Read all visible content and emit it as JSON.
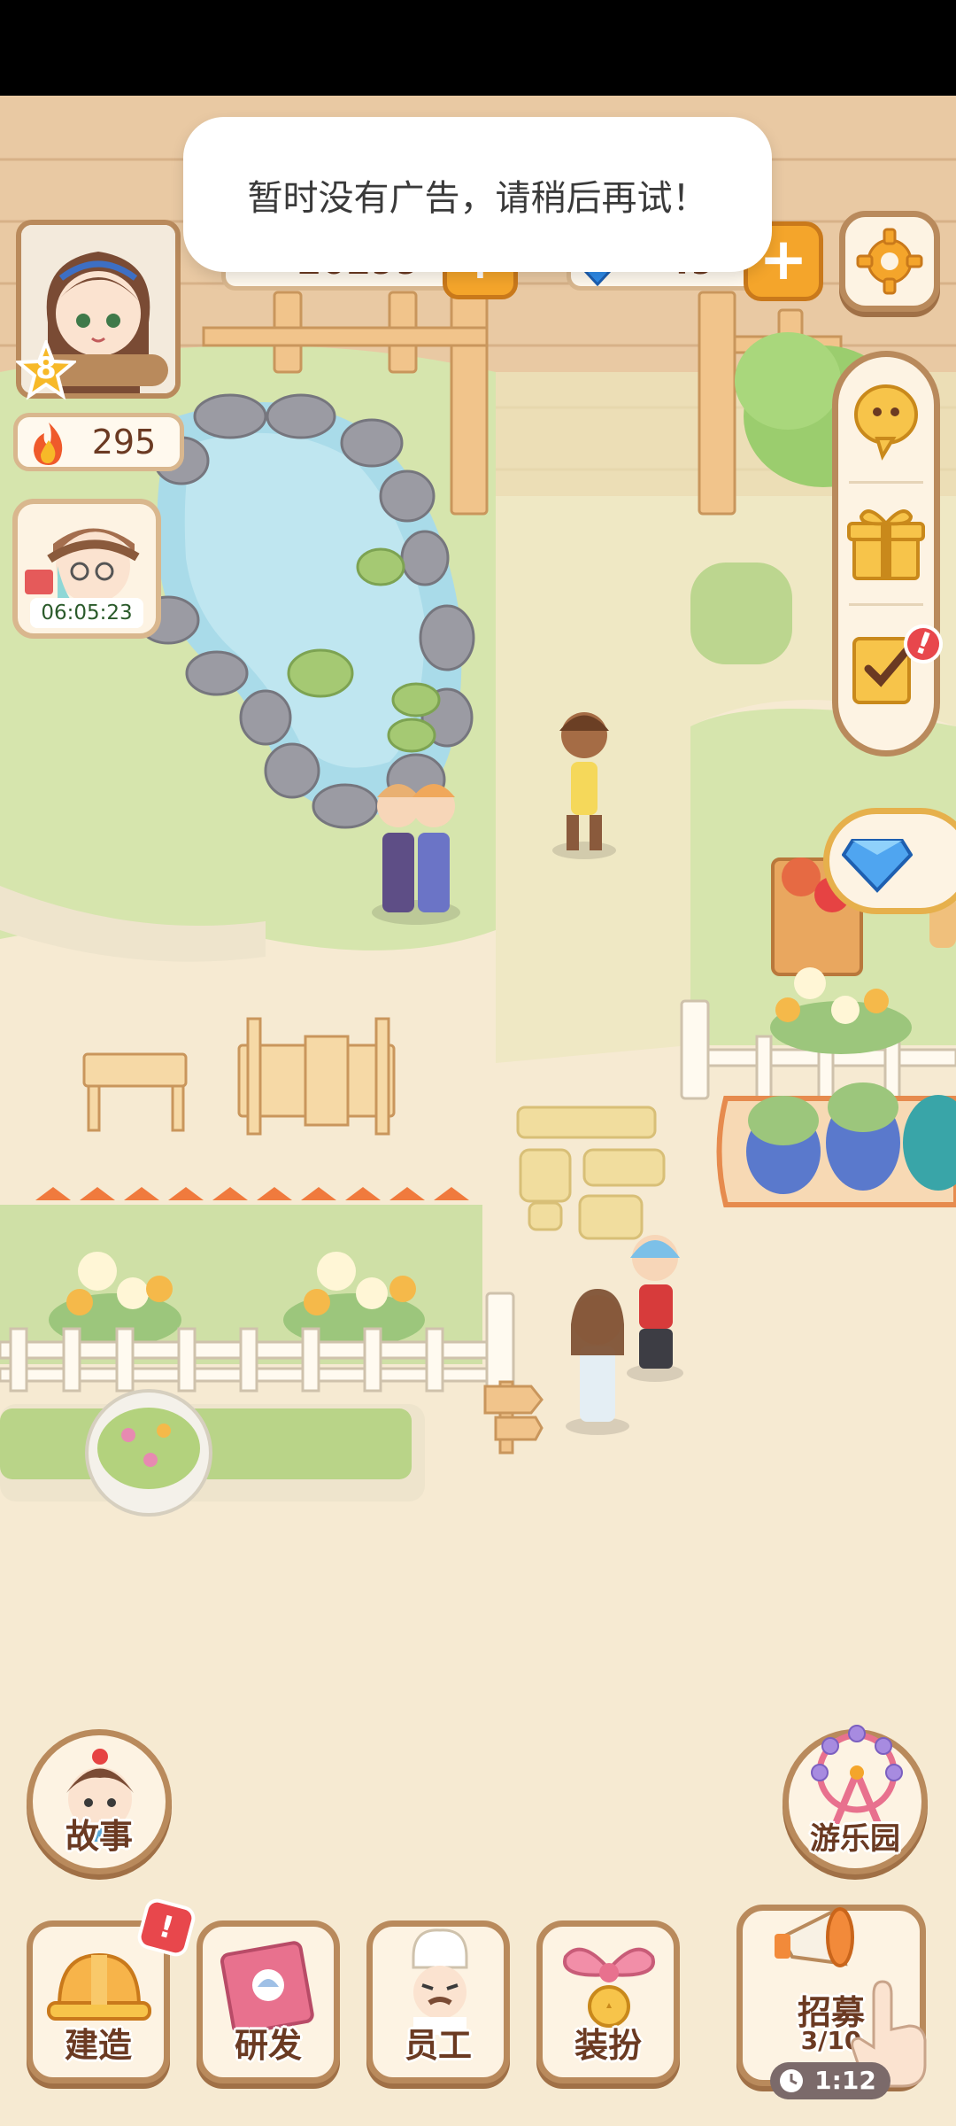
{
  "toast": {
    "message": "暂时没有广告，请稍后再试！"
  },
  "player": {
    "level": "8",
    "energy": "295"
  },
  "currency": {
    "coins": "20299",
    "gems": "49"
  },
  "event": {
    "timer": "06:05:23"
  },
  "side_menu": [
    {
      "icon": "chat-bubble-icon"
    },
    {
      "icon": "gift-box-icon"
    },
    {
      "icon": "checklist-icon",
      "has_alert": true
    }
  ],
  "bottom_nav": {
    "story": "故事",
    "amusement_park": "游乐园",
    "build": "建造",
    "research": "研发",
    "staff": "员工",
    "dress_up": "装扮",
    "recruit": "招募",
    "recruit_count": "3/10",
    "recruit_timer": "1:12"
  },
  "colors": {
    "accent_orange": "#f4a52b",
    "button_brown": "#b98a5c",
    "alert_red": "#e8474c",
    "grass": "#cfe0a6",
    "pond": "#9ed4e6"
  }
}
